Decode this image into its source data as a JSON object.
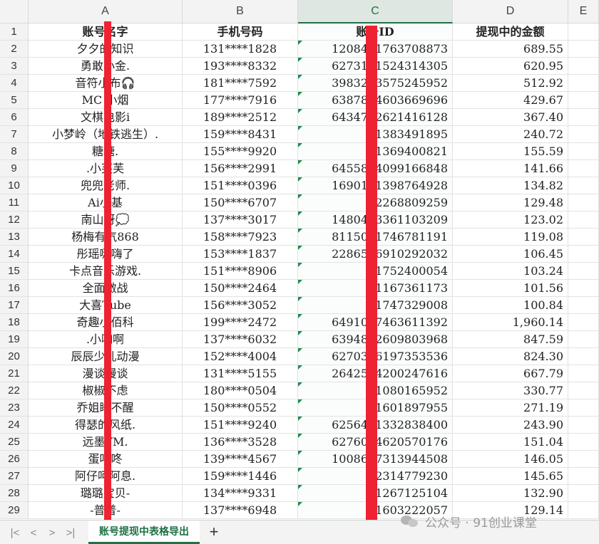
{
  "columns": [
    {
      "letter": "A",
      "selected": false
    },
    {
      "letter": "B",
      "selected": false
    },
    {
      "letter": "C",
      "selected": true
    },
    {
      "letter": "D",
      "selected": false
    },
    {
      "letter": "E",
      "selected": false
    }
  ],
  "header_row": {
    "num": "1",
    "a": "账号名字",
    "b": "手机号码",
    "c": "账号ID",
    "d": "提现中的金额"
  },
  "rows": [
    {
      "num": "2",
      "a": "夕夕的知识",
      "b": "131****1828",
      "c": "1208491763708873",
      "d": "689.55"
    },
    {
      "num": "3",
      "a": "勇敢小金.",
      "b": "193****8332",
      "c": "6273191524314305",
      "d": "620.95"
    },
    {
      "num": "4",
      "a": "音符小布🎧",
      "b": "181****7592",
      "c": "3983213575245952",
      "d": "512.92"
    },
    {
      "num": "5",
      "a": "MC 小烟",
      "b": "177****7916",
      "c": "6387844603669696",
      "d": "429.67"
    },
    {
      "num": "6",
      "a": "文棋电影i",
      "b": "189****2512",
      "c": "6434752621416128",
      "d": "367.40"
    },
    {
      "num": "7",
      "a": "小梦岭（地铁逃生）.",
      "b": "159****8431",
      "c": "1383491895",
      "d": "240.72"
    },
    {
      "num": "8",
      "a": "糖糖.",
      "b": "155****9920",
      "c": "1369400821",
      "d": "155.59"
    },
    {
      "num": "9",
      "a": ".小芙芙",
      "b": "156****2991",
      "c": "6455844099166848",
      "d": "141.66"
    },
    {
      "num": "10",
      "a": "兜兜老师.",
      "b": "151****0396",
      "c": "1690141398764928",
      "d": "134.82"
    },
    {
      "num": "11",
      "a": "Ai小基",
      "b": "150****6707",
      "c": "2268809259",
      "d": "129.48"
    },
    {
      "num": "12",
      "a": "南山呀💭",
      "b": "137****3017",
      "c": "1480423361103209",
      "d": "123.02"
    },
    {
      "num": "13",
      "a": "杨梅有气868",
      "b": "158****7923",
      "c": "8115071746781191",
      "d": "119.08"
    },
    {
      "num": "14",
      "a": "彤瑶嗨嗨了",
      "b": "153****1837",
      "c": "2286516910292032",
      "d": "106.45"
    },
    {
      "num": "15",
      "a": "卡点音乐游戏.",
      "b": "151****8906",
      "c": "1752400054",
      "d": "103.24"
    },
    {
      "num": "16",
      "a": "全面激战",
      "b": "150****2464",
      "c": "1167361173",
      "d": "101.56"
    },
    {
      "num": "17",
      "a": "大喜Tube",
      "b": "156****3052",
      "c": "1747329008",
      "d": "100.84"
    },
    {
      "num": "18",
      "a": "奇趣小佰科",
      "b": "199****2472",
      "c": "6491037463611392",
      "d": "1,960.14"
    },
    {
      "num": "19",
      "a": ".小咖啊",
      "b": "137****6032",
      "c": "6394822609803968",
      "d": "847.59"
    },
    {
      "num": "20",
      "a": "辰辰少儿动漫",
      "b": "152****4004",
      "c": "6270386197353536",
      "d": "824.30"
    },
    {
      "num": "21",
      "a": "漫谈漫谈",
      "b": "131****5155",
      "c": "2642564200247616",
      "d": "667.79"
    },
    {
      "num": "22",
      "a": "椒椒不虑",
      "b": "180****0504",
      "c": "1080165952",
      "d": "330.77"
    },
    {
      "num": "23",
      "a": "乔姐睡不醒",
      "b": "150****0552",
      "c": "1601897955",
      "d": "271.19"
    },
    {
      "num": "24",
      "a": "得瑟的风纸.",
      "b": "151****9240",
      "c": "6256491332838400",
      "d": "243.90"
    },
    {
      "num": "25",
      "a": "远墨YM.",
      "b": "136****3528",
      "c": "6276054620570176",
      "d": "151.04"
    },
    {
      "num": "26",
      "a": "蛋叮咚",
      "b": "139****4567",
      "c": "1008607313944508",
      "d": "146.05"
    },
    {
      "num": "27",
      "a": "阿仔呵阿息.",
      "b": "159****1446",
      "c": "2314779230",
      "d": "145.65"
    },
    {
      "num": "28",
      "a": "璐璐宝贝-",
      "b": "134****9331",
      "c": "1267125104",
      "d": "132.90"
    },
    {
      "num": "29",
      "a": "-普普-",
      "b": "137****6948",
      "c": "1603222057",
      "d": "129.14"
    }
  ],
  "sheet_tab": {
    "label": "账号提现中表格导出"
  },
  "nav": {
    "first": "|<",
    "prev": "<",
    "next": ">",
    "last": ">|",
    "add": "+"
  },
  "watermark": {
    "text": "公众号 · 91创业课堂"
  },
  "colors": {
    "accent": "#1e7145",
    "redact": "#ee2233"
  }
}
